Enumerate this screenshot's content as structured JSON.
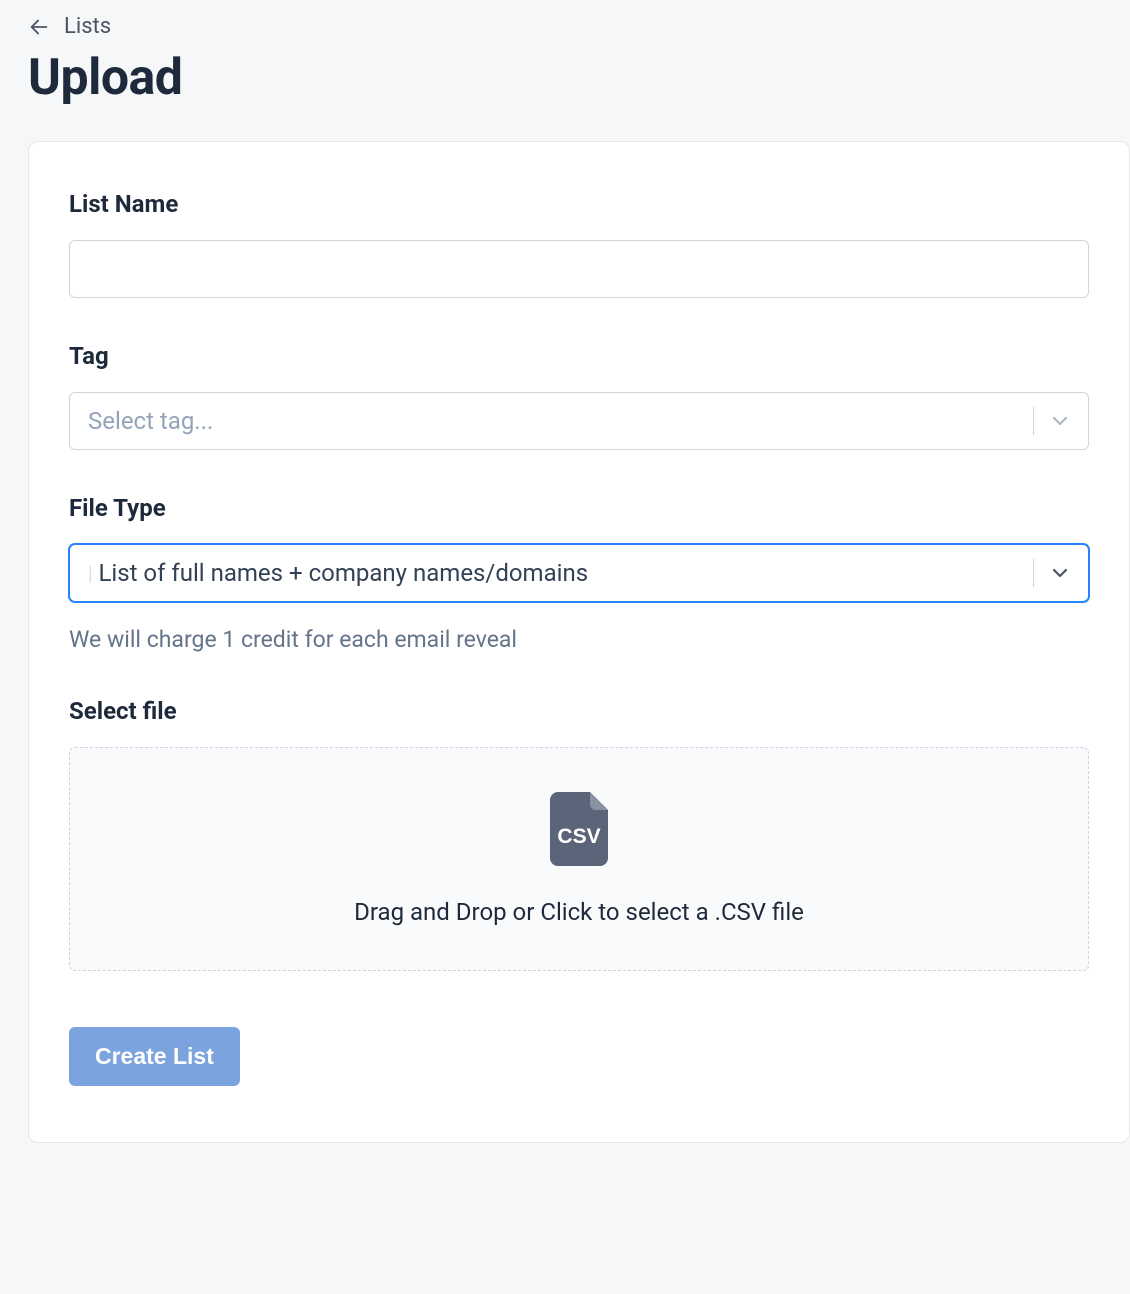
{
  "breadcrumb": {
    "back_label": "Lists"
  },
  "header": {
    "title": "Upload"
  },
  "form": {
    "list_name": {
      "label": "List Name",
      "value": ""
    },
    "tag": {
      "label": "Tag",
      "placeholder": "Select tag..."
    },
    "file_type": {
      "label": "File Type",
      "value": "List of full names + company names/domains",
      "hint": "We will charge 1 credit for each email reveal"
    },
    "select_file": {
      "label": "Select file",
      "dropzone_text": "Drag and Drop or Click to select a .CSV file",
      "icon_label": "CSV"
    },
    "submit_label": "Create List"
  }
}
